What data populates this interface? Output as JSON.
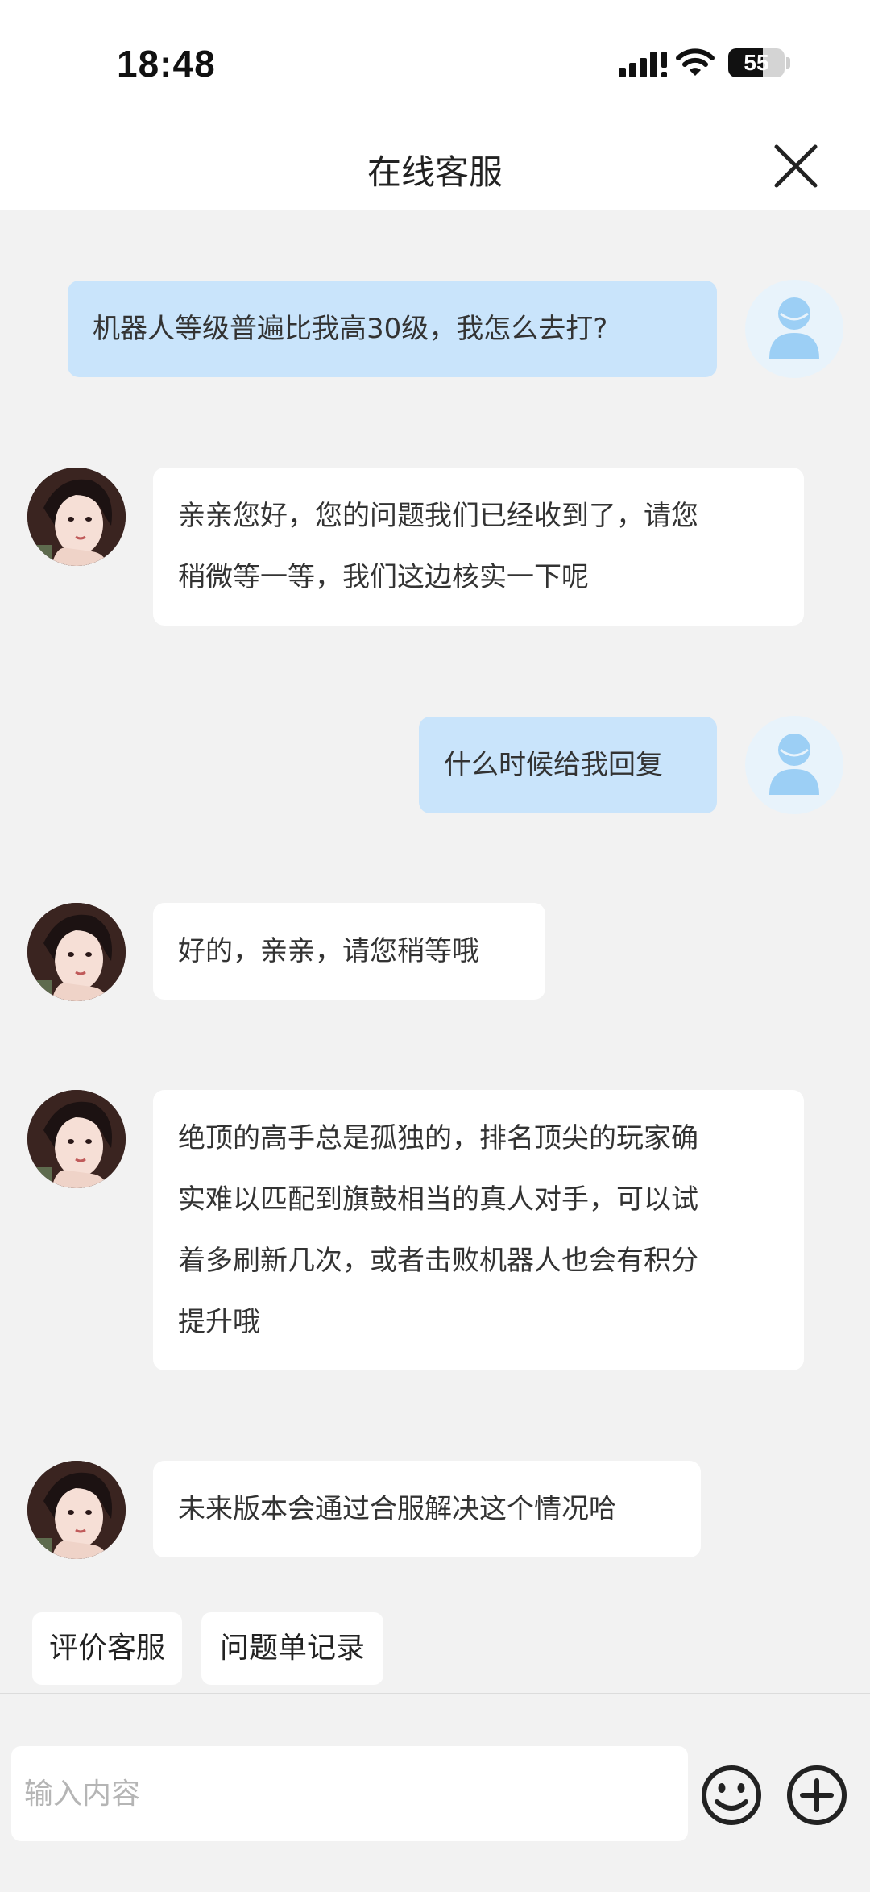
{
  "status_bar": {
    "time": "18:48",
    "battery": "55"
  },
  "nav": {
    "title": "在线客服",
    "close_icon": "close-icon"
  },
  "messages": [
    {
      "from": "user",
      "text": "机器人等级普遍比我高30级，我怎么去打?"
    },
    {
      "from": "agent",
      "text": "亲亲您好，您的问题我们已经收到了，请您\n稍微等一等，我们这边核实一下呢"
    },
    {
      "from": "user",
      "text": "什么时候给我回复"
    },
    {
      "from": "agent",
      "text": "好的，亲亲，请您稍等哦"
    },
    {
      "from": "agent",
      "text": "绝顶的高手总是孤独的，排名顶尖的玩家确\n实难以匹配到旗鼓相当的真人对手，可以试\n着多刷新几次，或者击败机器人也会有积分\n提升哦"
    },
    {
      "from": "agent",
      "text": "未来版本会通过合服解决这个情况哈"
    }
  ],
  "quick_actions": [
    "评价客服",
    "问题单记录"
  ],
  "input": {
    "placeholder": "输入内容",
    "emoji_icon": "smiley-icon",
    "plus_icon": "plus-circle-icon"
  },
  "colors": {
    "user_bubble": "#c9e4fb",
    "agent_bubble": "#ffffff",
    "background": "#f2f2f2"
  }
}
